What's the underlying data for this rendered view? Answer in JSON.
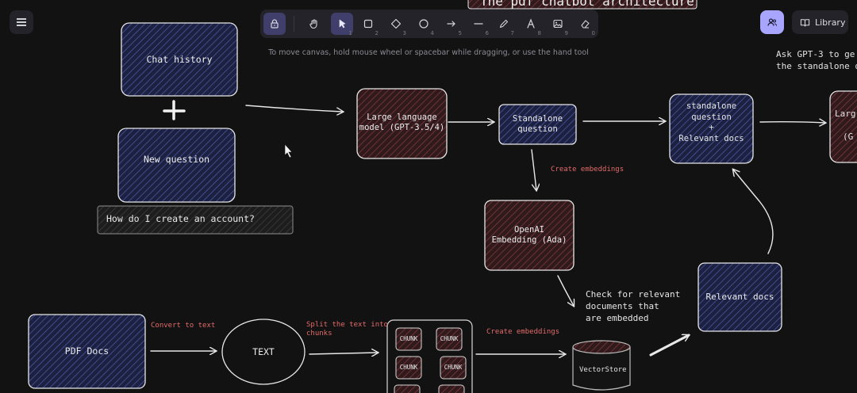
{
  "ui": {
    "menu_icon": "hamburger-menu-icon",
    "toolbar": {
      "tools": [
        {
          "name": "lock",
          "icon": "lock-icon",
          "key": ""
        },
        {
          "name": "hand",
          "icon": "hand-icon",
          "key": ""
        },
        {
          "name": "selection",
          "icon": "pointer-icon",
          "key": "1"
        },
        {
          "name": "rectangle",
          "icon": "rectangle-icon",
          "key": "2"
        },
        {
          "name": "diamond",
          "icon": "diamond-icon",
          "key": "3"
        },
        {
          "name": "ellipse",
          "icon": "ellipse-icon",
          "key": "4"
        },
        {
          "name": "arrow",
          "icon": "arrow-icon",
          "key": "5"
        },
        {
          "name": "line",
          "icon": "line-icon",
          "key": "6"
        },
        {
          "name": "draw",
          "icon": "pencil-icon",
          "key": "7"
        },
        {
          "name": "text",
          "icon": "text-icon",
          "key": "8"
        },
        {
          "name": "image",
          "icon": "image-icon",
          "key": "9"
        },
        {
          "name": "eraser",
          "icon": "eraser-icon",
          "key": "0"
        }
      ]
    },
    "hint": "To move canvas, hold mouse wheel or spacebar while dragging, or use the hand tool",
    "library_label": "Library",
    "accent": "#a8a5ff"
  },
  "canvas": {
    "title": "The pdf chatbot architecture",
    "chat_history": "Chat history",
    "plus": "+",
    "new_question": "New question",
    "example_question": "How do I create an account?",
    "llm_1": "Large language model (GPT-3.5/4)",
    "standalone_question": "Standalone question",
    "standalone_plus_docs": [
      "standalone",
      "question",
      "+",
      "Relevant docs"
    ],
    "llm_2_partial": [
      "Larg",
      "(G"
    ],
    "note_gpt3": [
      "Ask GPT-3 to ge",
      "the standalone q"
    ],
    "create_embeddings_1": "Create embeddings",
    "openai_embedding": "OpenAI Embedding (Ada)",
    "check_relevant": [
      "Check for relevant",
      "documents that",
      "are embedded"
    ],
    "relevant_docs": "Relevant docs",
    "pdf_docs": "PDF Docs",
    "convert_to_text": "Convert to text",
    "text_node": "TEXT",
    "split_text": [
      "Split the text into",
      "chunks"
    ],
    "chunk_label": "CHUNK",
    "create_embeddings_2": "Create embeddings",
    "vectorstore": "VectorStore",
    "colors": {
      "blue_fill": "#22284d",
      "red_fill": "#3a1e22",
      "red_text": "#e46b6b",
      "stroke": "#e8e8e8"
    }
  }
}
